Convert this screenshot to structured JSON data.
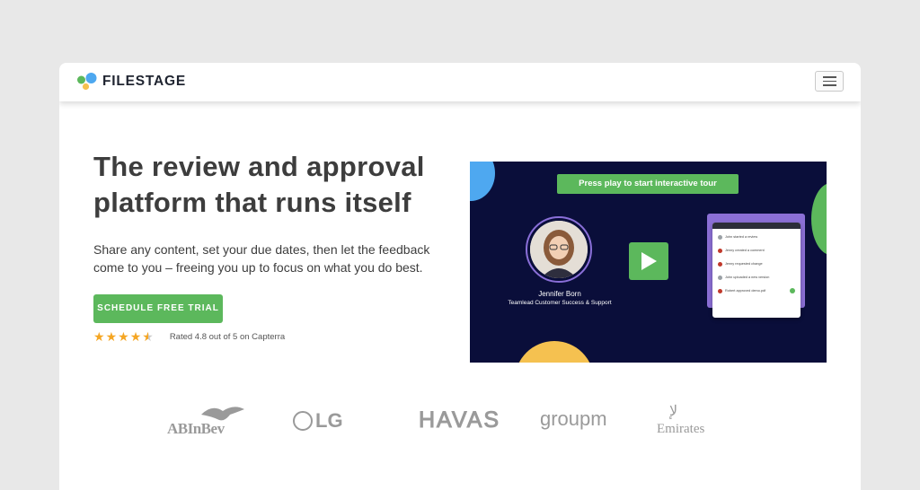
{
  "nav": {
    "brand": "FILESTAGE",
    "logo_colors": [
      "#4ea8f0",
      "#5cb85c",
      "#f5c150"
    ],
    "menu_icon": "hamburger-icon"
  },
  "hero": {
    "heading": "The review and approval platform that runs itself",
    "subtext": "Share any content, set your due dates, then let the feedback come to you – freeing you up to focus on what you do best.",
    "cta_label": "SCHEDULE FREE TRIAL",
    "rating": 4.8,
    "rating_text": "Rated 4.8 out of 5 on Capterra"
  },
  "video": {
    "tour_label": "Press play to start interactive tour",
    "presenter_name": "Jennifer Born",
    "presenter_role": "Teamlead Customer Success & Support",
    "play_icon": "play-icon",
    "activity": [
      {
        "text": "John started a review",
        "color": "#9aa0a6"
      },
      {
        "text": "Jenny created a comment",
        "color": "#c0392b"
      },
      {
        "text": "Jenny requested change",
        "color": "#c0392b"
      },
      {
        "text": "John uploaded a new version",
        "color": "#9aa0a6"
      },
      {
        "text": "Robert approved demo.pdf",
        "color": "#c0392b"
      }
    ]
  },
  "customers": [
    "ABInBev",
    "LG",
    "HAVAS",
    "groupm",
    "Emirates"
  ],
  "colors": {
    "accent": "#5cb85c",
    "video_bg": "#0a0e3a",
    "heading": "#3d3d3d",
    "star": "#f5a623"
  }
}
